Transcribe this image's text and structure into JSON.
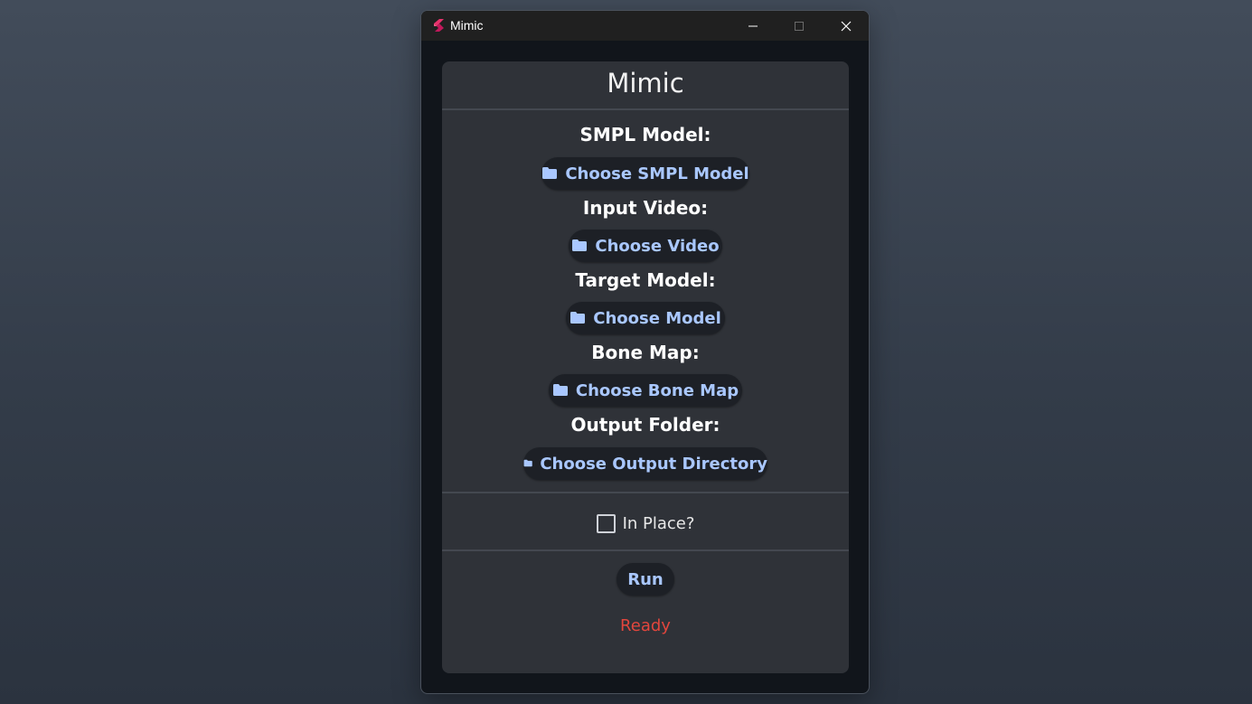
{
  "window": {
    "title": "Mimic",
    "app_icon": "flutter-logo-icon",
    "controls": [
      "minimize-icon",
      "maximize-icon",
      "close-icon"
    ]
  },
  "panel": {
    "heading": "Mimic"
  },
  "fields": [
    {
      "label": "SMPL Model:",
      "button": "Choose SMPL Model",
      "icon": "folder-icon"
    },
    {
      "label": "Input Video:",
      "button": "Choose Video",
      "icon": "folder-icon"
    },
    {
      "label": "Target Model:",
      "button": "Choose Model",
      "icon": "folder-icon"
    },
    {
      "label": "Bone Map:",
      "button": "Choose Bone Map",
      "icon": "folder-icon"
    },
    {
      "label": "Output Folder:",
      "button": "Choose Output Directory",
      "icon": "folder-icon"
    }
  ],
  "options": {
    "in_place_label": "In Place?",
    "in_place_checked": false
  },
  "actions": {
    "run_label": "Run"
  },
  "status": {
    "text": "Ready",
    "color": "#e2463d"
  },
  "theme": {
    "accent": "#a9c7ff",
    "panel_bg": "#2f3238",
    "window_bg": "#11151b"
  }
}
